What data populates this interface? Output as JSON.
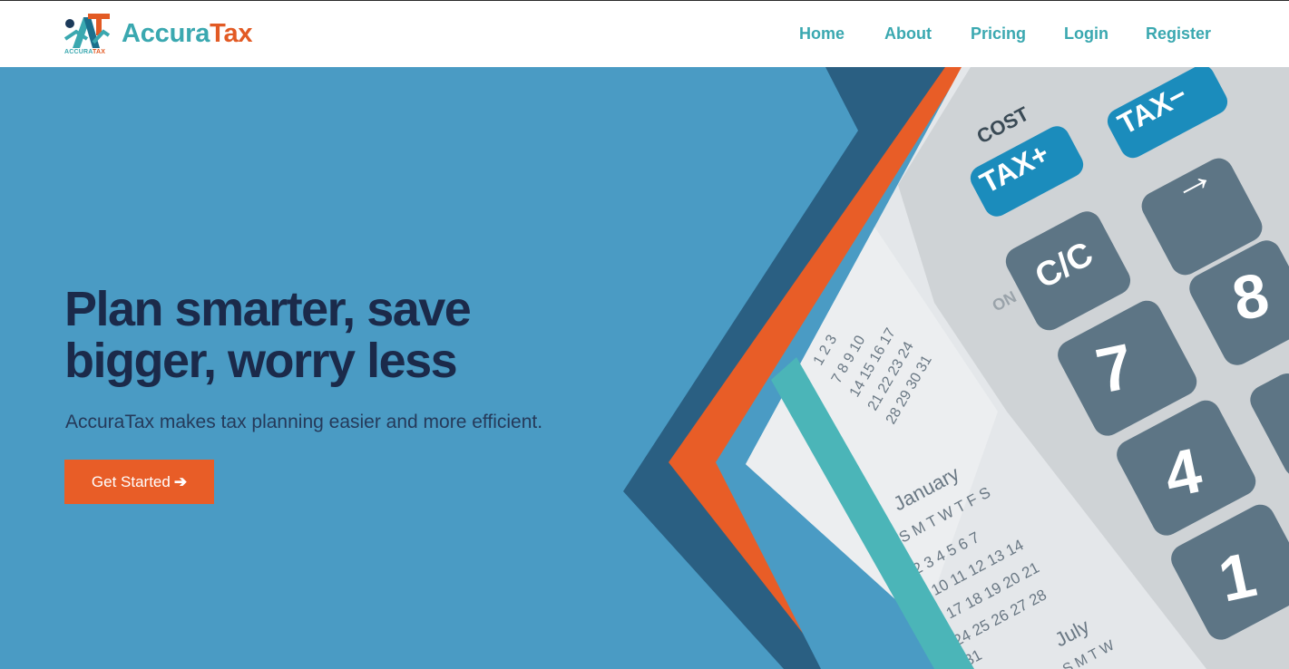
{
  "brand": {
    "name_part1": "Accura",
    "name_part2": "Tax",
    "logo_sub_part1": "ACCURA",
    "logo_sub_part2": "TAX",
    "colors": {
      "teal": "#3aa8b0",
      "orange": "#e25a24",
      "navy": "#1b2a4a",
      "hero_blue": "#4a9bc4"
    }
  },
  "nav": {
    "items": [
      {
        "label": "Home"
      },
      {
        "label": "About"
      },
      {
        "label": "Pricing"
      },
      {
        "label": "Login"
      },
      {
        "label": "Register"
      }
    ]
  },
  "hero": {
    "headline": "Plan smarter, save bigger, worry less",
    "subtitle": "AccuraTax makes tax planning easier and more efficient.",
    "cta_label": "Get Started",
    "cta_icon": "arrow-right-icon",
    "image": {
      "keys": {
        "cost": "COST",
        "tax_plus": "TAX+",
        "tax_minus": "TAX−",
        "cc": "C/C",
        "on": "ON",
        "seven": "7",
        "eight": "8",
        "four": "4",
        "one": "1",
        "arrow": "→"
      },
      "calendar": {
        "month1": "January",
        "weekdays1": "S M T W T F S",
        "rows1": [
          "2 3 4 5 6 7",
          "9 10 11 12 13 14",
          "16 17 18 19 20 21",
          "23 24 25 26 27 28",
          "30 31"
        ],
        "month2": "July",
        "weekdays2": "S M T W",
        "top_rows": [
          "1 2 3",
          "7 8 9 10",
          "14 15 16 17",
          "21 22 23 24",
          "28 29 30 31"
        ]
      }
    }
  }
}
